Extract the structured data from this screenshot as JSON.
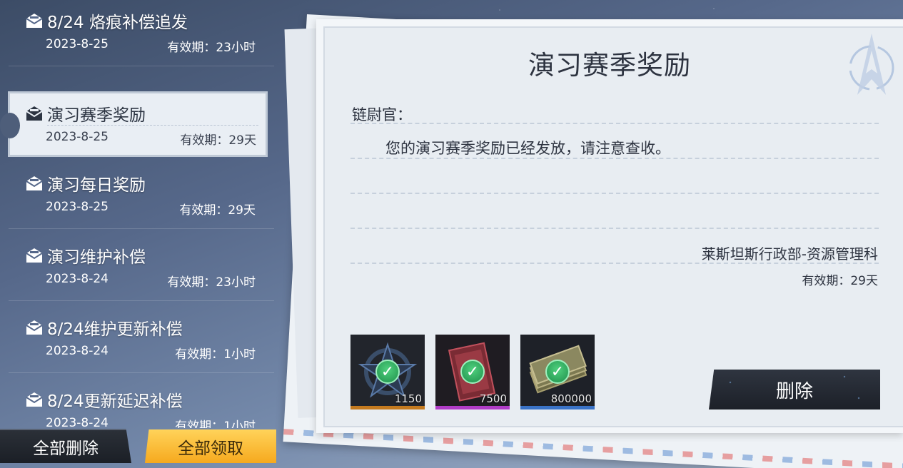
{
  "mail_list": [
    {
      "title": "8/24 烙痕补偿追发",
      "date": "2023-8-25",
      "expiry": "有效期：23小时",
      "selected": false
    },
    {
      "title": "演习赛季奖励",
      "date": "2023-8-25",
      "expiry": "有效期：29天",
      "selected": true
    },
    {
      "title": "演习每日奖励",
      "date": "2023-8-25",
      "expiry": "有效期：29天",
      "selected": false
    },
    {
      "title": "演习维护补偿",
      "date": "2023-8-24",
      "expiry": "有效期：23小时",
      "selected": false
    },
    {
      "title": "8/24维护更新补偿",
      "date": "2023-8-24",
      "expiry": "有效期：1小时",
      "selected": false
    },
    {
      "title": "8/24更新延迟补偿",
      "date": "2023-8-24",
      "expiry": "有效期：1小时",
      "selected": false
    }
  ],
  "buttons": {
    "delete_all": "全部删除",
    "claim_all": "全部领取",
    "delete": "删除"
  },
  "letter": {
    "title": "演习赛季奖励",
    "salutation": "链尉官：",
    "body": "您的演习赛季奖励已经发放，请注意查收。",
    "sender": "莱斯坦斯行政部-资源管理科",
    "expiry": "有效期：29天"
  },
  "rewards": [
    {
      "icon": "star-emblem-icon",
      "quantity": "1150",
      "claimed": true,
      "rarity_color": "#c47a1f"
    },
    {
      "icon": "red-card-icon",
      "quantity": "7500",
      "claimed": true,
      "rarity_color": "#b03cc7"
    },
    {
      "icon": "cash-stack-icon",
      "quantity": "800000",
      "claimed": true,
      "rarity_color": "#3a73c7"
    }
  ]
}
